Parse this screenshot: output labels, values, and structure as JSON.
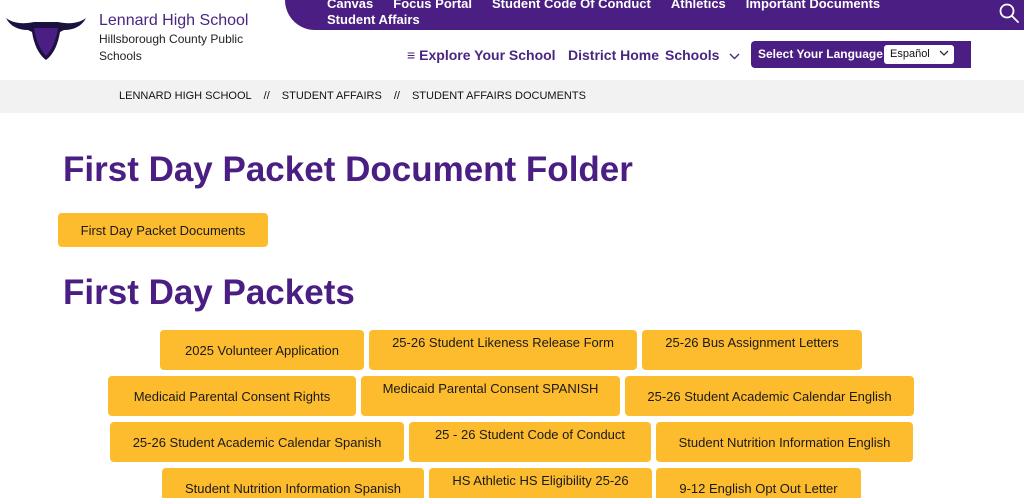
{
  "header": {
    "school_name": "Lennard High School",
    "district_lines": [
      "Hillsborough County Public",
      "Schools"
    ],
    "top_links": [
      "Canvas",
      "Focus Portal",
      "Student Code Of Conduct",
      "Athletics",
      "Important Documents",
      "Student Affairs"
    ],
    "nav": {
      "explore": "Explore Your School",
      "district_home": "District Home",
      "schools": "Schools"
    },
    "language": {
      "label": "Select Your Language",
      "selected": "Español"
    },
    "colors": {
      "brand_purple": "#4a1e82",
      "accent_gold": "#fdbb2e"
    }
  },
  "breadcrumb": [
    "LENNARD HIGH SCHOOL",
    "STUDENT AFFAIRS",
    "STUDENT AFFAIRS DOCUMENTS"
  ],
  "breadcrumb_separator": "//",
  "main": {
    "heading_1": "First Day Packet Document Folder",
    "folder_button": "First Day Packet Documents",
    "heading_2": "First Day Packets",
    "packets": [
      "2025 Volunteer Application",
      "25-26 Student Likeness Release Form",
      "25-26 Bus Assignment Letters",
      "Medicaid Parental Consent Rights",
      "Medicaid Parental Consent SPANISH",
      "25-26 Student Academic Calendar English",
      "25-26 Student Academic Calendar Spanish",
      "25 - 26 Student Code of Conduct",
      "Student Nutrition Information English",
      "Student Nutrition Information Spanish",
      "HS Athletic HS Eligibility 25-26",
      "9-12 English Opt Out Letter"
    ]
  }
}
